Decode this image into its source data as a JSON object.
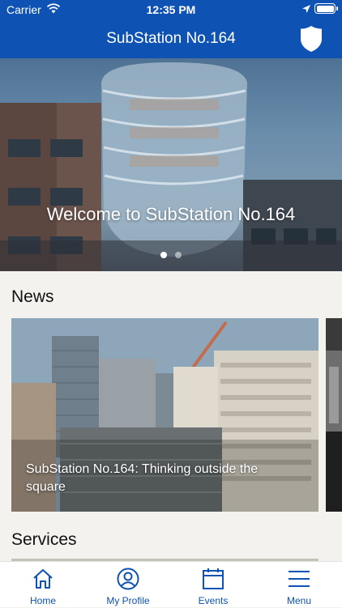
{
  "status_bar": {
    "carrier": "Carrier",
    "time": "12:35 PM"
  },
  "nav": {
    "title": "SubStation No.164",
    "icon": "shield-icon"
  },
  "hero": {
    "title": "Welcome to SubStation No.164",
    "slide_count": 2,
    "active_slide": 1
  },
  "news": {
    "heading": "News",
    "cards": [
      {
        "caption": "SubStation No.164: Thinking outside the square"
      }
    ]
  },
  "services": {
    "heading": "Services"
  },
  "tabs": [
    {
      "label": "Home",
      "icon": "home-icon"
    },
    {
      "label": "My Profile",
      "icon": "profile-icon"
    },
    {
      "label": "Events",
      "icon": "calendar-icon"
    },
    {
      "label": "Menu",
      "icon": "menu-icon"
    }
  ],
  "colors": {
    "brand": "#0e52b3",
    "background": "#f4f2ee"
  }
}
